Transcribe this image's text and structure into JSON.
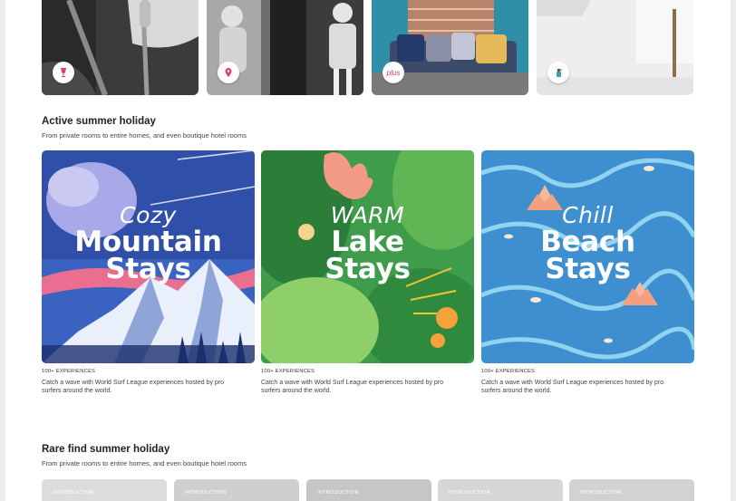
{
  "top_row": {
    "photos": [
      {
        "badge_icon": "wine-glass-icon",
        "badge_color": "#d8455f"
      },
      {
        "badge_icon": "map-pin-icon",
        "badge_color": "#e0445e"
      },
      {
        "badge_icon": "plus-logo-icon",
        "badge_text": "plus",
        "badge_color": "#d8437d"
      },
      {
        "badge_icon": "spray-bottle-icon",
        "badge_color": "#3aa3a6"
      }
    ]
  },
  "active_section": {
    "title": "Active summer holiday",
    "subtitle": "From private rooms to entire homes, and even boutique hotel rooms",
    "cards": [
      {
        "script": "Cozy",
        "line1": "Mountain",
        "line2": "Stays",
        "kicker": "100+ EXPERIENCES",
        "desc": "Catch a wave with World Surf League experiences hosted by pro surfers around the world."
      },
      {
        "script": "WARM",
        "line1": "Lake",
        "line2": "Stays",
        "kicker": "100+ EXPERIENCES",
        "desc": "Catch a wave with World Surf League experiences hosted by pro surfers around the world."
      },
      {
        "script": "Chill",
        "line1": "Beach",
        "line2": "Stays",
        "kicker": "100+ EXPERIENCES",
        "desc": "Catch a wave with World Surf League experiences hosted by pro surfers around the world."
      }
    ]
  },
  "rare_section": {
    "title": "Rare find summer holiday",
    "subtitle": "From private rooms to entire homes, and even boutique hotel rooms",
    "tiles": [
      "INTRODUCTION",
      "INTRODUCTION",
      "INTRODUCTION",
      "INTRODUCTION",
      "INTRODUCTION"
    ]
  },
  "colors": {
    "mountain_sky": "#2f4fa8",
    "lake_green": "#3f9c4a",
    "beach_blue": "#3d8fd0"
  }
}
